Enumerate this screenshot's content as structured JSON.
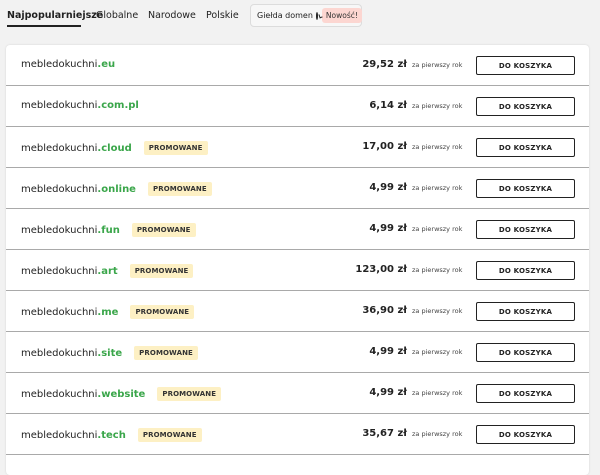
{
  "tabs": [
    {
      "label": "Najpopularniejsze",
      "active": true
    },
    {
      "label": "Globalne",
      "active": false
    },
    {
      "label": "Narodowe",
      "active": false
    },
    {
      "label": "Polskie",
      "active": false
    }
  ],
  "market": {
    "label": "Giełda domen",
    "icon": "clock-icon",
    "badge": "Nowość!"
  },
  "colors": {
    "tld": "#3aa64a",
    "promo_bg": "#fdf0c4",
    "new_badge_bg": "#fcd6d1"
  },
  "period_label": "za pierwszy rok",
  "cart_label": "DO KOSZYKA",
  "promo_label": "PROMOWANE",
  "domains": [
    {
      "name": "mebledokuchni",
      "tld": ".eu",
      "promoted": false,
      "price": "29,52 zł"
    },
    {
      "name": "mebledokuchni",
      "tld": ".com.pl",
      "promoted": false,
      "price": "6,14 zł"
    },
    {
      "name": "mebledokuchni",
      "tld": ".cloud",
      "promoted": true,
      "price": "17,00 zł"
    },
    {
      "name": "mebledokuchni",
      "tld": ".online",
      "promoted": true,
      "price": "4,99 zł"
    },
    {
      "name": "mebledokuchni",
      "tld": ".fun",
      "promoted": true,
      "price": "4,99 zł"
    },
    {
      "name": "mebledokuchni",
      "tld": ".art",
      "promoted": true,
      "price": "123,00 zł"
    },
    {
      "name": "mebledokuchni",
      "tld": ".me",
      "promoted": true,
      "price": "36,90 zł"
    },
    {
      "name": "mebledokuchni",
      "tld": ".site",
      "promoted": true,
      "price": "4,99 zł"
    },
    {
      "name": "mebledokuchni",
      "tld": ".website",
      "promoted": true,
      "price": "4,99 zł"
    },
    {
      "name": "mebledokuchni",
      "tld": ".tech",
      "promoted": true,
      "price": "35,67 zł"
    }
  ]
}
